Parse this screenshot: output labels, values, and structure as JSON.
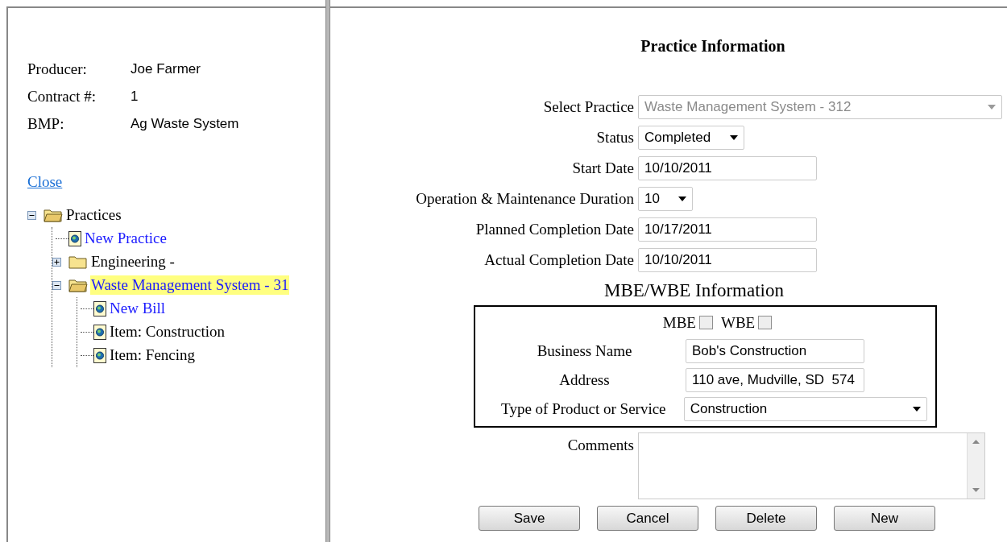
{
  "info": [
    {
      "label": "Producer:",
      "value": "Joe Farmer"
    },
    {
      "label": "Contract #:",
      "value": "1"
    },
    {
      "label": "BMP:",
      "value": "Ag Waste System"
    }
  ],
  "close_link": "Close",
  "tree": [
    {
      "label": "Practices",
      "kind": "folder",
      "expanded": true,
      "selected": false,
      "link": false,
      "children": [
        {
          "label": "New Practice",
          "kind": "page",
          "selected": false,
          "link": true
        },
        {
          "label": "Engineering -",
          "kind": "folder",
          "expanded": false,
          "selected": false,
          "link": false
        },
        {
          "label": "Waste Management System - 31",
          "kind": "folder",
          "expanded": true,
          "selected": true,
          "link": true,
          "children": [
            {
              "label": "New Bill",
              "kind": "page",
              "selected": false,
              "link": true
            },
            {
              "label": "Item: Construction",
              "kind": "page",
              "selected": false,
              "link": false
            },
            {
              "label": "Item: Fencing",
              "kind": "page",
              "selected": false,
              "link": false
            }
          ]
        }
      ]
    }
  ],
  "title": "Practice Information",
  "fields": [
    {
      "label": "Select Practice",
      "kind": "select",
      "value": "Waste Management System - 312",
      "disabled": true
    },
    {
      "label": "Status",
      "kind": "select",
      "value": "Completed",
      "disabled": false
    },
    {
      "label": "Start Date",
      "kind": "text",
      "value": "10/10/2011",
      "disabled": false
    },
    {
      "label": "Operation & Maintenance Duration",
      "kind": "select",
      "value": "10",
      "disabled": false
    },
    {
      "label": "Planned Completion Date",
      "kind": "text",
      "value": "10/17/2011",
      "disabled": false
    },
    {
      "label": "Actual Completion Date",
      "kind": "text",
      "value": "10/10/2011",
      "disabled": false
    }
  ],
  "mbe_heading": "MBE/WBE Information",
  "mbe_checks": [
    {
      "label": "MBE",
      "checked": false
    },
    {
      "label": "WBE",
      "checked": false
    }
  ],
  "mbe_fields": [
    {
      "label": "Business Name",
      "kind": "text",
      "value": "Bob's Construction"
    },
    {
      "label": "Address",
      "kind": "text",
      "value": "110 ave, Mudville, SD  574"
    },
    {
      "label": "Type of Product or Service",
      "kind": "select",
      "value": "Construction"
    }
  ],
  "comments": {
    "label": "Comments"
  },
  "buttons": [
    "Save",
    "Cancel",
    "Delete",
    "New"
  ]
}
